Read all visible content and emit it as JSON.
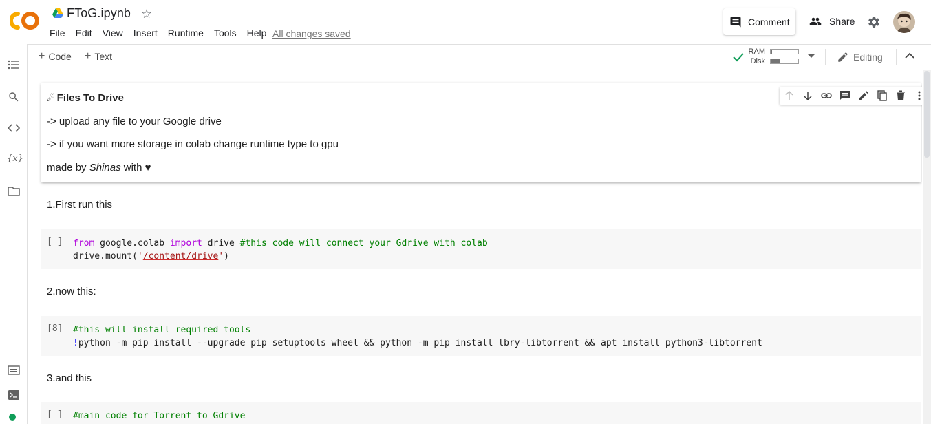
{
  "header": {
    "title": "FToG.ipynb",
    "menu": [
      "File",
      "Edit",
      "View",
      "Insert",
      "Runtime",
      "Tools",
      "Help"
    ],
    "save_status": "All changes saved",
    "comment_label": "Comment",
    "share_label": "Share"
  },
  "toolbar": {
    "add_code": "Code",
    "add_text": "Text",
    "ram_label": "RAM",
    "disk_label": "Disk",
    "ram_usage": 0.05,
    "disk_usage": 0.35,
    "editing_label": "Editing"
  },
  "cells": {
    "intro": {
      "heading": "Files To Drive",
      "line1": "-> upload any file to your Google drive",
      "line2": "-> if you want more storage in colab change runtime type to gpu",
      "credit_prefix": "made by ",
      "credit_name": "Shinas",
      "credit_suffix": " with ♥"
    },
    "step1_text": "1.First run this",
    "code1": {
      "exec": "[ ]",
      "kw_from": "from",
      "mod": " google.colab ",
      "kw_import": "import",
      "name": " drive ",
      "comment": "#this code will connect your Gdrive with colab",
      "line2_pre": "drive.mount(",
      "line2_q1": "'",
      "line2_str": "/content/drive",
      "line2_q2": "'",
      "line2_post": ")"
    },
    "step2_text": "2.now this:",
    "code2": {
      "exec": "[8]",
      "comment": "#this will install required tools",
      "bang": "!",
      "cmd": "python -m pip install --upgrade pip setuptools wheel && python -m pip install lbry-libtorrent && apt install python3-libtorrent"
    },
    "step3_text": "3.and this",
    "code3": {
      "exec": "[ ]",
      "comment": "#main code for Torrent to Gdrive"
    }
  },
  "colors": {
    "keyword": "#af00db",
    "comment": "#008000",
    "string": "#a31515",
    "status_connected": "#0f9d58"
  }
}
